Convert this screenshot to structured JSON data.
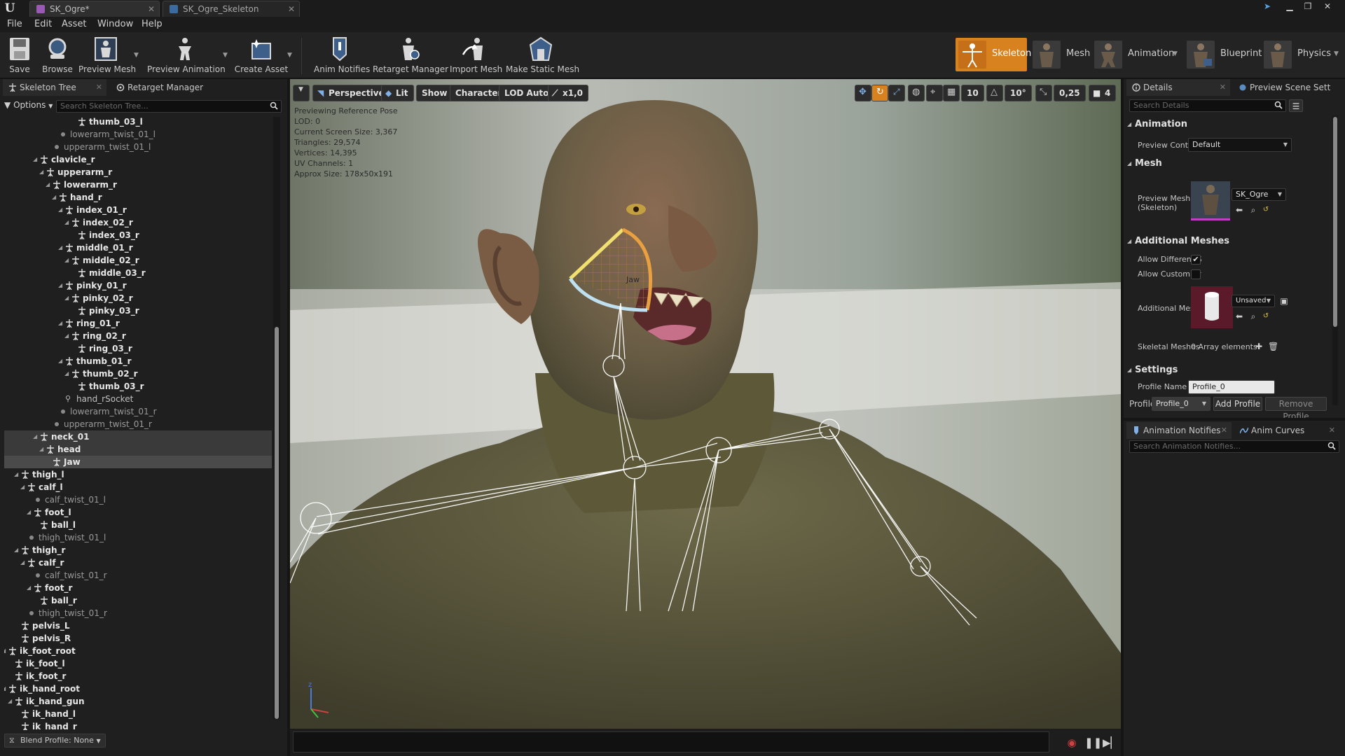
{
  "tabs": [
    {
      "label": "SK_Ogre*",
      "active": true
    },
    {
      "label": "SK_Ogre_Skeleton",
      "active": false
    }
  ],
  "menu": [
    "File",
    "Edit",
    "Asset",
    "Window",
    "Help"
  ],
  "toolbar": {
    "save": "Save",
    "browse": "Browse",
    "preview_mesh": "Preview Mesh",
    "preview_animation": "Preview Animation",
    "create_asset": "Create Asset",
    "anim_notifies": "Anim Notifies",
    "retarget_manager": "Retarget Manager",
    "import_mesh": "Import Mesh",
    "make_static_mesh": "Make Static Mesh"
  },
  "modes": [
    {
      "label": "Skeleton",
      "active": true
    },
    {
      "label": "Mesh",
      "active": false
    },
    {
      "label": "Animation",
      "active": false
    },
    {
      "label": "Blueprint",
      "active": false
    },
    {
      "label": "Physics",
      "active": false
    }
  ],
  "left_panel": {
    "tabs": [
      "Skeleton Tree",
      "Retarget Manager"
    ],
    "options_label": "Options",
    "search_placeholder": "Search Skeleton Tree...",
    "blend_profile": "Blend Profile: None"
  },
  "tree": [
    {
      "label": "thumb_03_l",
      "type": "bone",
      "depth": 13,
      "state": ""
    },
    {
      "label": "lowerarm_twist_01_l",
      "type": "virt",
      "depth": 10,
      "state": ""
    },
    {
      "label": "upperarm_twist_01_l",
      "type": "virt",
      "depth": 9,
      "state": ""
    },
    {
      "label": "clavicle_r",
      "type": "bone",
      "depth": 7,
      "state": ""
    },
    {
      "label": "upperarm_r",
      "type": "bone",
      "depth": 8,
      "state": ""
    },
    {
      "label": "lowerarm_r",
      "type": "bone",
      "depth": 9,
      "state": ""
    },
    {
      "label": "hand_r",
      "type": "bone",
      "depth": 10,
      "state": ""
    },
    {
      "label": "index_01_r",
      "type": "bone",
      "depth": 11,
      "state": ""
    },
    {
      "label": "index_02_r",
      "type": "bone",
      "depth": 12,
      "state": ""
    },
    {
      "label": "index_03_r",
      "type": "bone",
      "depth": 13,
      "state": ""
    },
    {
      "label": "middle_01_r",
      "type": "bone",
      "depth": 11,
      "state": ""
    },
    {
      "label": "middle_02_r",
      "type": "bone",
      "depth": 12,
      "state": ""
    },
    {
      "label": "middle_03_r",
      "type": "bone",
      "depth": 13,
      "state": ""
    },
    {
      "label": "pinky_01_r",
      "type": "bone",
      "depth": 11,
      "state": ""
    },
    {
      "label": "pinky_02_r",
      "type": "bone",
      "depth": 12,
      "state": ""
    },
    {
      "label": "pinky_03_r",
      "type": "bone",
      "depth": 13,
      "state": ""
    },
    {
      "label": "ring_01_r",
      "type": "bone",
      "depth": 11,
      "state": ""
    },
    {
      "label": "ring_02_r",
      "type": "bone",
      "depth": 12,
      "state": ""
    },
    {
      "label": "ring_03_r",
      "type": "bone",
      "depth": 13,
      "state": ""
    },
    {
      "label": "thumb_01_r",
      "type": "bone",
      "depth": 11,
      "state": ""
    },
    {
      "label": "thumb_02_r",
      "type": "bone",
      "depth": 12,
      "state": ""
    },
    {
      "label": "thumb_03_r",
      "type": "bone",
      "depth": 13,
      "state": ""
    },
    {
      "label": "hand_rSocket",
      "type": "sock",
      "depth": 11,
      "state": ""
    },
    {
      "label": "lowerarm_twist_01_r",
      "type": "virt",
      "depth": 10,
      "state": ""
    },
    {
      "label": "upperarm_twist_01_r",
      "type": "virt",
      "depth": 9,
      "state": ""
    },
    {
      "label": "neck_01",
      "type": "bone",
      "depth": 7,
      "state": "high"
    },
    {
      "label": "head",
      "type": "bone",
      "depth": 8,
      "state": "high"
    },
    {
      "label": "Jaw",
      "type": "bone",
      "depth": 9,
      "state": "sel"
    },
    {
      "label": "thigh_l",
      "type": "bone",
      "depth": 4,
      "state": ""
    },
    {
      "label": "calf_l",
      "type": "bone",
      "depth": 5,
      "state": ""
    },
    {
      "label": "calf_twist_01_l",
      "type": "virt",
      "depth": 6,
      "state": ""
    },
    {
      "label": "foot_l",
      "type": "bone",
      "depth": 6,
      "state": ""
    },
    {
      "label": "ball_l",
      "type": "bone",
      "depth": 7,
      "state": ""
    },
    {
      "label": "thigh_twist_01_l",
      "type": "virt",
      "depth": 5,
      "state": ""
    },
    {
      "label": "thigh_r",
      "type": "bone",
      "depth": 4,
      "state": ""
    },
    {
      "label": "calf_r",
      "type": "bone",
      "depth": 5,
      "state": ""
    },
    {
      "label": "calf_twist_01_r",
      "type": "virt",
      "depth": 6,
      "state": ""
    },
    {
      "label": "foot_r",
      "type": "bone",
      "depth": 6,
      "state": ""
    },
    {
      "label": "ball_r",
      "type": "bone",
      "depth": 7,
      "state": ""
    },
    {
      "label": "thigh_twist_01_r",
      "type": "virt",
      "depth": 5,
      "state": ""
    },
    {
      "label": "pelvis_L",
      "type": "bone",
      "depth": 4,
      "state": ""
    },
    {
      "label": "pelvis_R",
      "type": "bone",
      "depth": 4,
      "state": ""
    },
    {
      "label": "ik_foot_root",
      "type": "bone",
      "depth": 2,
      "state": ""
    },
    {
      "label": "ik_foot_l",
      "type": "bone",
      "depth": 3,
      "state": ""
    },
    {
      "label": "ik_foot_r",
      "type": "bone",
      "depth": 3,
      "state": ""
    },
    {
      "label": "ik_hand_root",
      "type": "bone",
      "depth": 2,
      "state": ""
    },
    {
      "label": "ik_hand_gun",
      "type": "bone",
      "depth": 3,
      "state": ""
    },
    {
      "label": "ik_hand_l",
      "type": "bone",
      "depth": 4,
      "state": ""
    },
    {
      "label": "ik_hand_r",
      "type": "bone",
      "depth": 4,
      "state": ""
    }
  ],
  "viewport": {
    "perspective": "Perspective",
    "lit": "Lit",
    "show": "Show",
    "character": "Character",
    "lod": "LOD Auto",
    "speed": "x1,0",
    "grid_snap": "10",
    "rot_snap": "10°",
    "scale_snap": "0,25",
    "cam_speed": "4",
    "info": [
      "Previewing Reference Pose",
      "LOD: 0",
      "Current Screen Size: 3,367",
      "Triangles: 29,574",
      "Vertices: 14,395",
      "UV Channels: 1",
      "Approx Size: 178x50x191"
    ],
    "bone_label": "Jaw"
  },
  "right_panel": {
    "tabs": [
      "Details",
      "Preview Scene Sett"
    ],
    "search_placeholder": "Search Details",
    "animation_section": "Animation",
    "preview_controller_label": "Preview Controll",
    "preview_controller_value": "Default",
    "mesh_section": "Mesh",
    "preview_mesh_label": "Preview Mesh",
    "preview_mesh_sub": "(Skeleton)",
    "preview_mesh_value": "SK_Ogre",
    "additional_section": "Additional Meshes",
    "allow_different_label": "Allow Different S",
    "allow_different_checked": true,
    "allow_custom_label": "Allow Custom Ar",
    "allow_custom_checked": false,
    "additional_mesh_label": "Additional Meshe",
    "additional_mesh_value": "Unsaved",
    "skeletal_meshes_label": "Skeletal Meshes",
    "skeletal_meshes_value": "0 Array elements",
    "settings_section": "Settings",
    "profile_name_label": "Profile Name",
    "profile_name_value": "Profile_0",
    "profile_label": "Profile",
    "profile_value": "Profile_0",
    "add_profile": "Add Profile",
    "remove_profile": "Remove Profile",
    "lower_tabs": [
      "Animation Notifies",
      "Anim Curves"
    ],
    "notifies_search_placeholder": "Search Animation Notifies..."
  },
  "colors": {
    "accent_orange": "#d7821f",
    "selection": "#4a4a4a",
    "panel_bg": "#1f1f1f"
  }
}
